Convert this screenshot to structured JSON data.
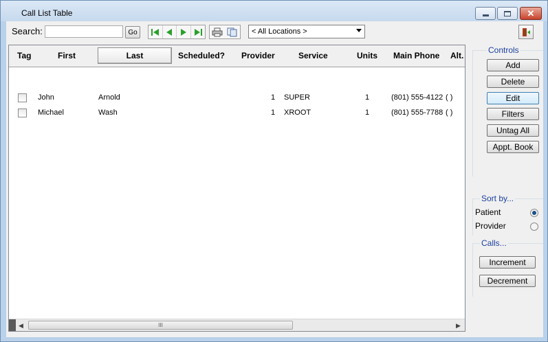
{
  "window": {
    "title": "Call List Table"
  },
  "toolbar": {
    "search_label": "Search:",
    "search_value": "",
    "go_label": "Go",
    "location_selected": "< All Locations >"
  },
  "table": {
    "columns": [
      "Tag",
      "First",
      "Last",
      "Scheduled?",
      "Provider",
      "Service",
      "Units",
      "Main Phone",
      "Alt."
    ],
    "rows": [
      {
        "first": "John",
        "last": "Arnold",
        "provider": "1",
        "service": "SUPER",
        "units": "1",
        "main_phone": "(801) 555-4122",
        "alt": "(  )"
      },
      {
        "first": "Michael",
        "last": "Wash",
        "provider": "1",
        "service": "XROOT",
        "units": "1",
        "main_phone": "(801) 555-7788",
        "alt": "(  )"
      }
    ],
    "scroll_grip": "III"
  },
  "controls": {
    "title": "Controls",
    "add": "Add",
    "delete": "Delete",
    "edit": "Edit",
    "filters": "Filters",
    "untag_all": "Untag All",
    "appt_book": "Appt. Book"
  },
  "sort_by": {
    "title": "Sort by...",
    "patient": "Patient",
    "provider": "Provider",
    "selected": "Patient"
  },
  "calls": {
    "title": "Calls...",
    "increment": "Increment",
    "decrement": "Decrement"
  },
  "colors": {
    "accent_title": "#1a3f9c",
    "nav_arrow": "#2aa02a",
    "close_button": "#c8432c"
  },
  "icons": [
    "app-icon",
    "minimize-icon",
    "maximize-icon",
    "close-icon",
    "first-record-icon",
    "prev-record-icon",
    "next-record-icon",
    "last-record-icon",
    "print-icon",
    "copy-icon",
    "exit-door-icon",
    "chevron-down-icon"
  ]
}
